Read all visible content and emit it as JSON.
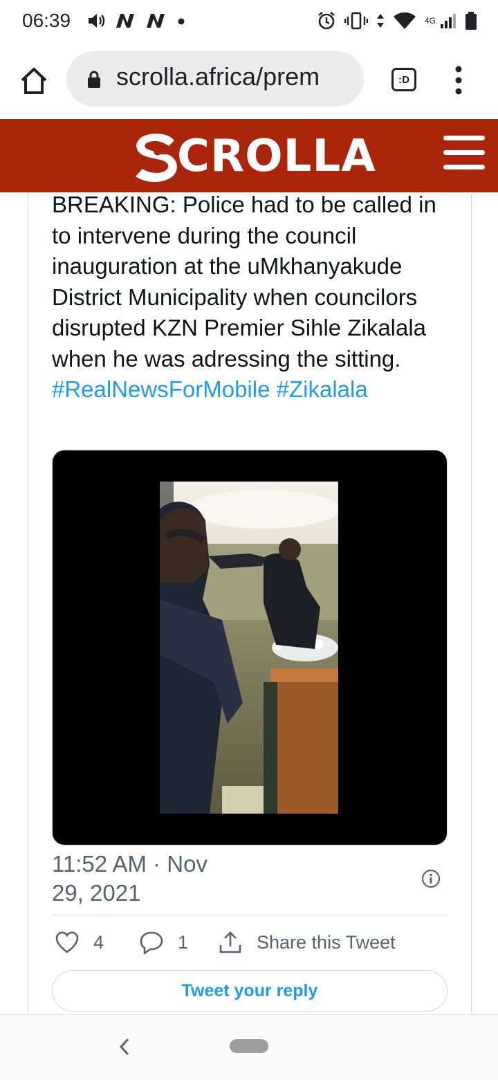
{
  "status_bar": {
    "time": "06:39",
    "network_label": "4G",
    "left_icons": [
      "volume-icon",
      "n-notification-icon",
      "n-notification-icon",
      "dot-icon"
    ],
    "right_icons": [
      "alarm-icon",
      "vibrate-icon",
      "data-arrows-icon",
      "wifi-icon",
      "signal-icon",
      "battery-icon"
    ]
  },
  "browser": {
    "url": "scrolla.africa/prem",
    "tabs_label": ":D",
    "icons": {
      "home": "home-icon",
      "lock": "lock-icon",
      "menu": "more-vert-icon"
    }
  },
  "site": {
    "brand_initial": "S",
    "brand_rest": "CROLLA",
    "header_color": "#ab250b",
    "menu_icon": "hamburger-icon"
  },
  "tweet": {
    "text": "BREAKING: Police had to be called in to intervene during the council inauguration at the uMkhanyakude District Municipality when councilors disrupted KZN Premier Sihle Zikalala when he was adressing the sitting.",
    "hashtags": [
      "#RealNewsForMobile",
      "#Zikalala"
    ],
    "timestamp_line1": "11:52 AM · Nov",
    "timestamp_line2": "29, 2021",
    "likes": "4",
    "replies": "1",
    "share_label": "Share this Tweet",
    "reply_button": "Tweet your reply",
    "link_color": "#1d9bf0"
  },
  "nav": {
    "back_icon": "back-chevron-icon",
    "home_icon": "home-pill-icon"
  }
}
